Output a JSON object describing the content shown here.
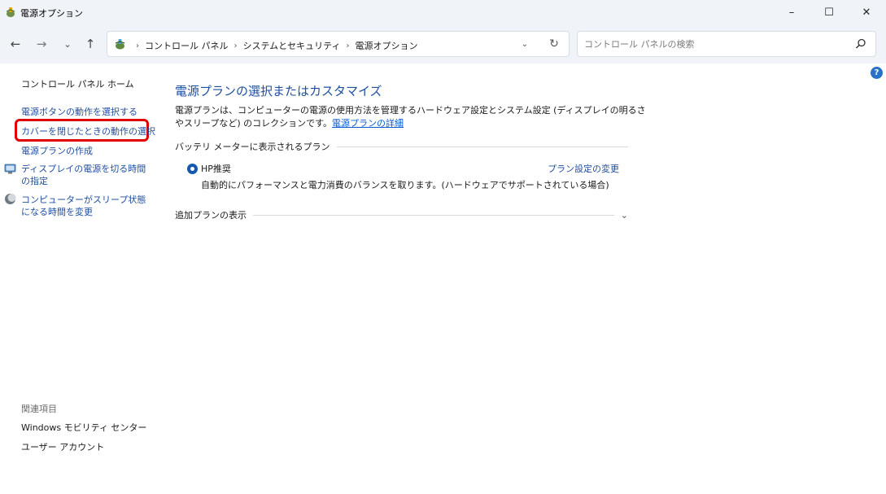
{
  "window": {
    "title": "電源オプション",
    "minimize_glyph": "–",
    "maximize_glyph": "☐",
    "close_glyph": "✕"
  },
  "nav": {
    "back_glyph": "←",
    "forward_glyph": "→",
    "recent_glyph": "⌄",
    "up_glyph": "↑"
  },
  "address": {
    "breadcrumbs": [
      "コントロール パネル",
      "システムとセキュリティ",
      "電源オプション"
    ],
    "separator": "›",
    "dropdown_glyph": "⌄",
    "refresh_glyph": "↻"
  },
  "search": {
    "placeholder": "コントロール パネルの検索"
  },
  "help": {
    "glyph": "?"
  },
  "sidebar": {
    "home": "コントロール パネル ホーム",
    "links": [
      "電源ボタンの動作を選択する",
      "カバーを閉じたときの動作の選択",
      "電源プランの作成",
      "ディスプレイの電源を切る時間の指定",
      "コンピューターがスリープ状態になる時間を変更"
    ],
    "related_heading": "関連項目",
    "related": [
      "Windows モビリティ センター",
      "ユーザー アカウント"
    ]
  },
  "main": {
    "title": "電源プランの選択またはカスタマイズ",
    "description": "電源プランは、コンピューターの電源の使用方法を管理するハードウェア設定とシステム設定 (ディスプレイの明るさやスリープなど) のコレクションです。",
    "details_link": "電源プランの詳細",
    "battery_section": "バッテリ メーターに表示されるプラン",
    "plan": {
      "name": "HP推奨",
      "selected": true,
      "settings_link": "プラン設定の変更",
      "description": "自動的にパフォーマンスと電力消費のバランスを取ります。(ハードウェアでサポートされている場合)"
    },
    "extra_section": "追加プランの表示",
    "extra_chevron": "⌄"
  },
  "colors": {
    "accent": "#1f4e9e",
    "link": "#0b5bd3",
    "highlight": "#e00000",
    "chrome": "#f0f4f9"
  },
  "icons": {
    "app": "power-options-icon",
    "address": "control-panel-icon",
    "search": "search-icon",
    "display": "display-icon",
    "sleep": "sleep-moon-icon"
  }
}
